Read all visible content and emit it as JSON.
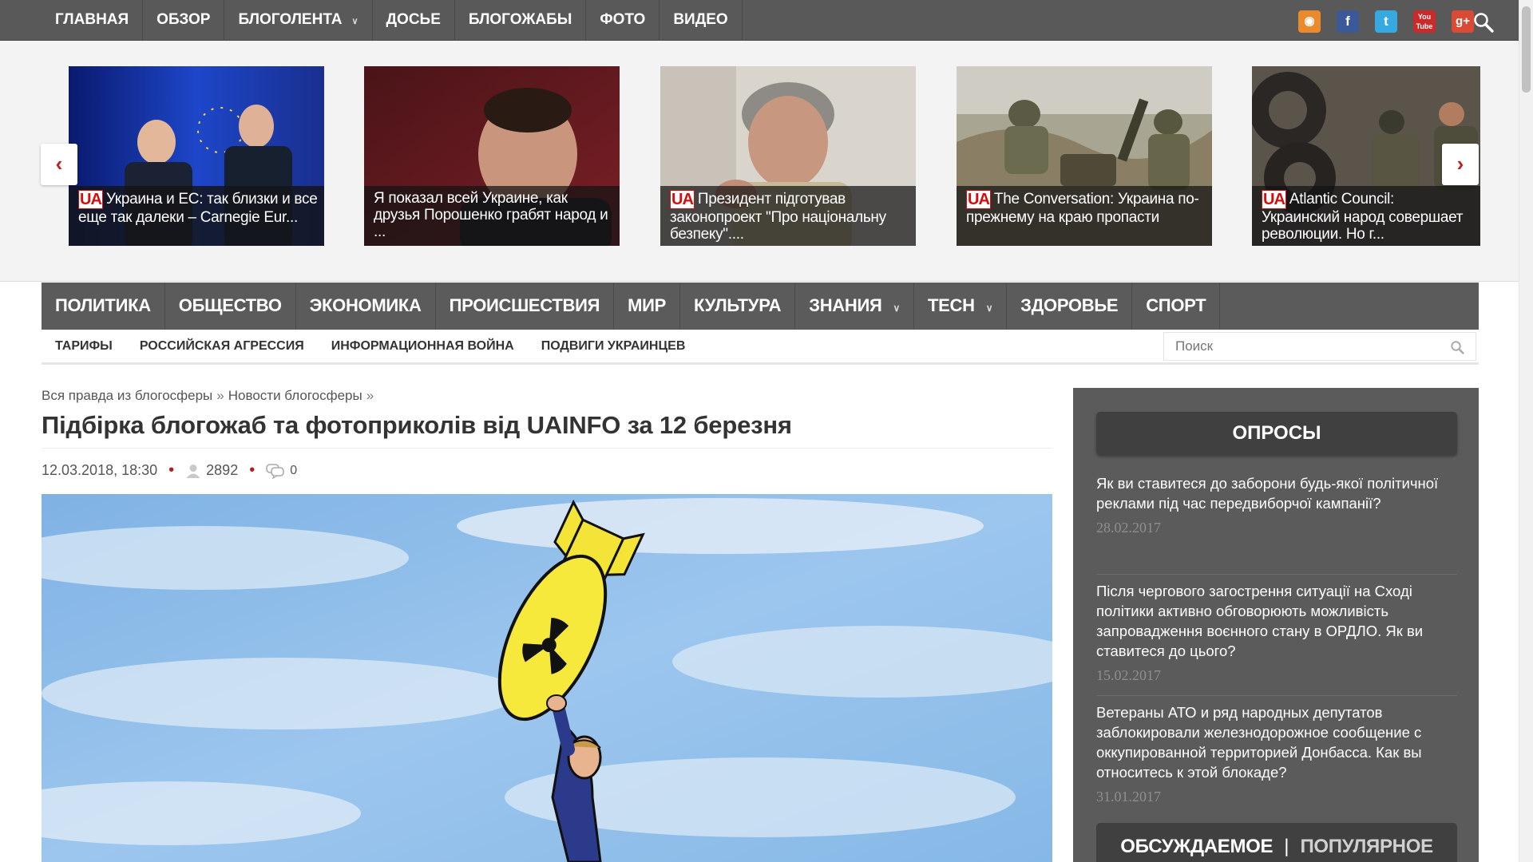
{
  "top_nav": {
    "items": [
      {
        "label": "ГЛАВНАЯ"
      },
      {
        "label": "ОБЗОР"
      },
      {
        "label": "БЛОГОЛЕНТА",
        "has_dropdown": true
      },
      {
        "label": "ДОСЬЕ"
      },
      {
        "label": "БЛОГОЖАБЫ"
      },
      {
        "label": "ФОТО"
      },
      {
        "label": "ВИДЕО"
      }
    ],
    "social": [
      {
        "name": "rss-icon",
        "glyph": "◉"
      },
      {
        "name": "facebook-icon",
        "glyph": "f"
      },
      {
        "name": "twitter-icon",
        "glyph": "t"
      },
      {
        "name": "youtube-icon",
        "glyph": "You Tube"
      },
      {
        "name": "google-plus-icon",
        "glyph": "g+"
      }
    ]
  },
  "carousel": {
    "prev_label": "‹",
    "next_label": "›",
    "ua_logo": "UA",
    "slides": [
      {
        "caption": "Украина и ЕС: так близки и все еще так далеки – Carnegie Eur...",
        "has_ua": true
      },
      {
        "caption": "Я показал всей Украине, как друзья Порошенко грабят народ и ...",
        "has_ua": false
      },
      {
        "caption": "Президент підготував законопроект \"Про національну безпеку\"....",
        "has_ua": true
      },
      {
        "caption": "The Conversation: Украина по-прежнему на краю пропасти",
        "has_ua": true
      },
      {
        "caption": "Atlantic Council: Украинский народ совершает революции. Но г...",
        "has_ua": true
      }
    ]
  },
  "main_nav": {
    "items": [
      {
        "label": "ПОЛИТИКА"
      },
      {
        "label": "ОБЩЕСТВО"
      },
      {
        "label": "ЭКОНОМИКА"
      },
      {
        "label": "ПРОИСШЕСТВИЯ"
      },
      {
        "label": "МИР"
      },
      {
        "label": "КУЛЬТУРА"
      },
      {
        "label": "ЗНАНИЯ",
        "has_dropdown": true
      },
      {
        "label": "TECH",
        "has_dropdown": true
      },
      {
        "label": "ЗДОРОВЬЕ"
      },
      {
        "label": "СПОРТ"
      }
    ]
  },
  "sub_nav": {
    "items": [
      {
        "label": "ТАРИФЫ"
      },
      {
        "label": "РОССИЙСКАЯ АГРЕССИЯ"
      },
      {
        "label": "ИНФОРМАЦИОННАЯ ВОЙНА"
      },
      {
        "label": "ПОДВИГИ УКРАИНЦЕВ"
      }
    ],
    "search_placeholder": "Поиск"
  },
  "article": {
    "breadcrumb": [
      "Вся правда из блогосферы",
      "Новости блогосферы"
    ],
    "breadcrumb_sep": "»",
    "title": "Підбірка блогожаб та фотоприколів від UAINFO за 12 березня",
    "date": "12.03.2018, 18:30",
    "views": "2892",
    "comments": "0"
  },
  "sidebar": {
    "title": "ОПРОСЫ",
    "polls": [
      {
        "question": "Як ви ставитеся до заборони будь-якої політичної реклами під час передвиборчої кампанії?",
        "date": "28.02.2017"
      },
      {
        "question": "Після чергового загострення ситуації на Сході політики активно обговорюють можливість запровадження воєнного стану в ОРДЛО. Як ви ставитеся до цього?",
        "date": "15.02.2017"
      },
      {
        "question": "Ветераны АТО и ряд народных депутатов заблокировали железнодорожное сообщение с оккупированной территорией Донбасса. Как вы относитесь к этой блокаде?",
        "date": "31.01.2017"
      }
    ],
    "tabs": [
      "ОБСУЖДАЕМОЕ",
      "ПОПУЛЯРНОЕ"
    ],
    "tab_sep": "|"
  },
  "colors": {
    "nav_bg": "#5b5b5b",
    "accent_red": "#c41d1d",
    "sidebar_bg": "#5b5b5b",
    "sidebar_header_bg": "#404040"
  }
}
